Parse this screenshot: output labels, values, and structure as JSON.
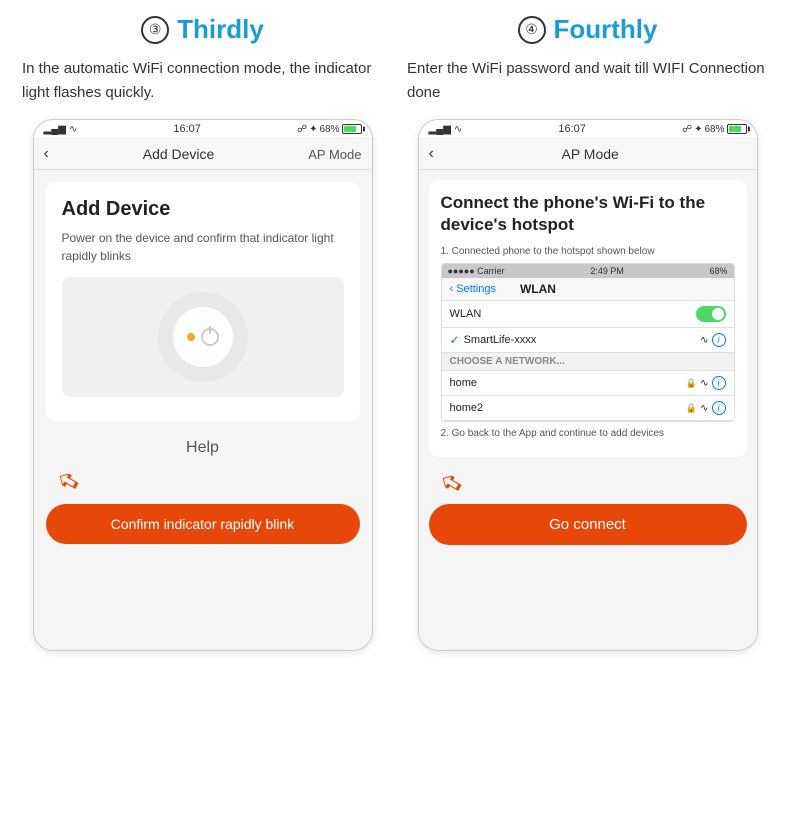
{
  "left": {
    "step_number": "③",
    "step_title": "Thirdly",
    "description": "In the automatic WiFi connection mode, the indicator light flashes quickly.",
    "status_bar": {
      "time": "16:07",
      "battery": "68%",
      "signal": "●●●"
    },
    "nav": {
      "back": "‹",
      "title": "Add Device",
      "right": "AP Mode"
    },
    "card": {
      "title": "Add Device",
      "description": "Power on the device and confirm that indicator light rapidly blinks"
    },
    "help_label": "Help",
    "confirm_button": "Confirm indicator rapidly blink"
  },
  "right": {
    "step_number": "④",
    "step_title": "Fourthly",
    "description": "Enter the WiFi password and wait till WIFI Connection done",
    "status_bar": {
      "time": "16:07",
      "battery": "68%"
    },
    "nav": {
      "back": "‹",
      "title": "AP Mode",
      "right": ""
    },
    "content": {
      "title": "Connect the phone's Wi-Fi to the device's hotspot",
      "instruction1": "1.  Connected phone to the hotspot shown below",
      "wifi_status_time": "2:49 PM",
      "wifi_carrier": "●●●●● Carrier",
      "wifi_battery": "68%",
      "wifi_nav_back": "‹ Settings",
      "wifi_nav_title": "WLAN",
      "wlan_label": "WLAN",
      "smartlife_ssid": "SmartLife-xxxx",
      "choose_network": "CHOOSE A NETWORK...",
      "networks": [
        "home",
        "home2"
      ],
      "instruction2": "2. Go back to the App and continue to add devices"
    },
    "go_connect_button": "Go connect"
  }
}
